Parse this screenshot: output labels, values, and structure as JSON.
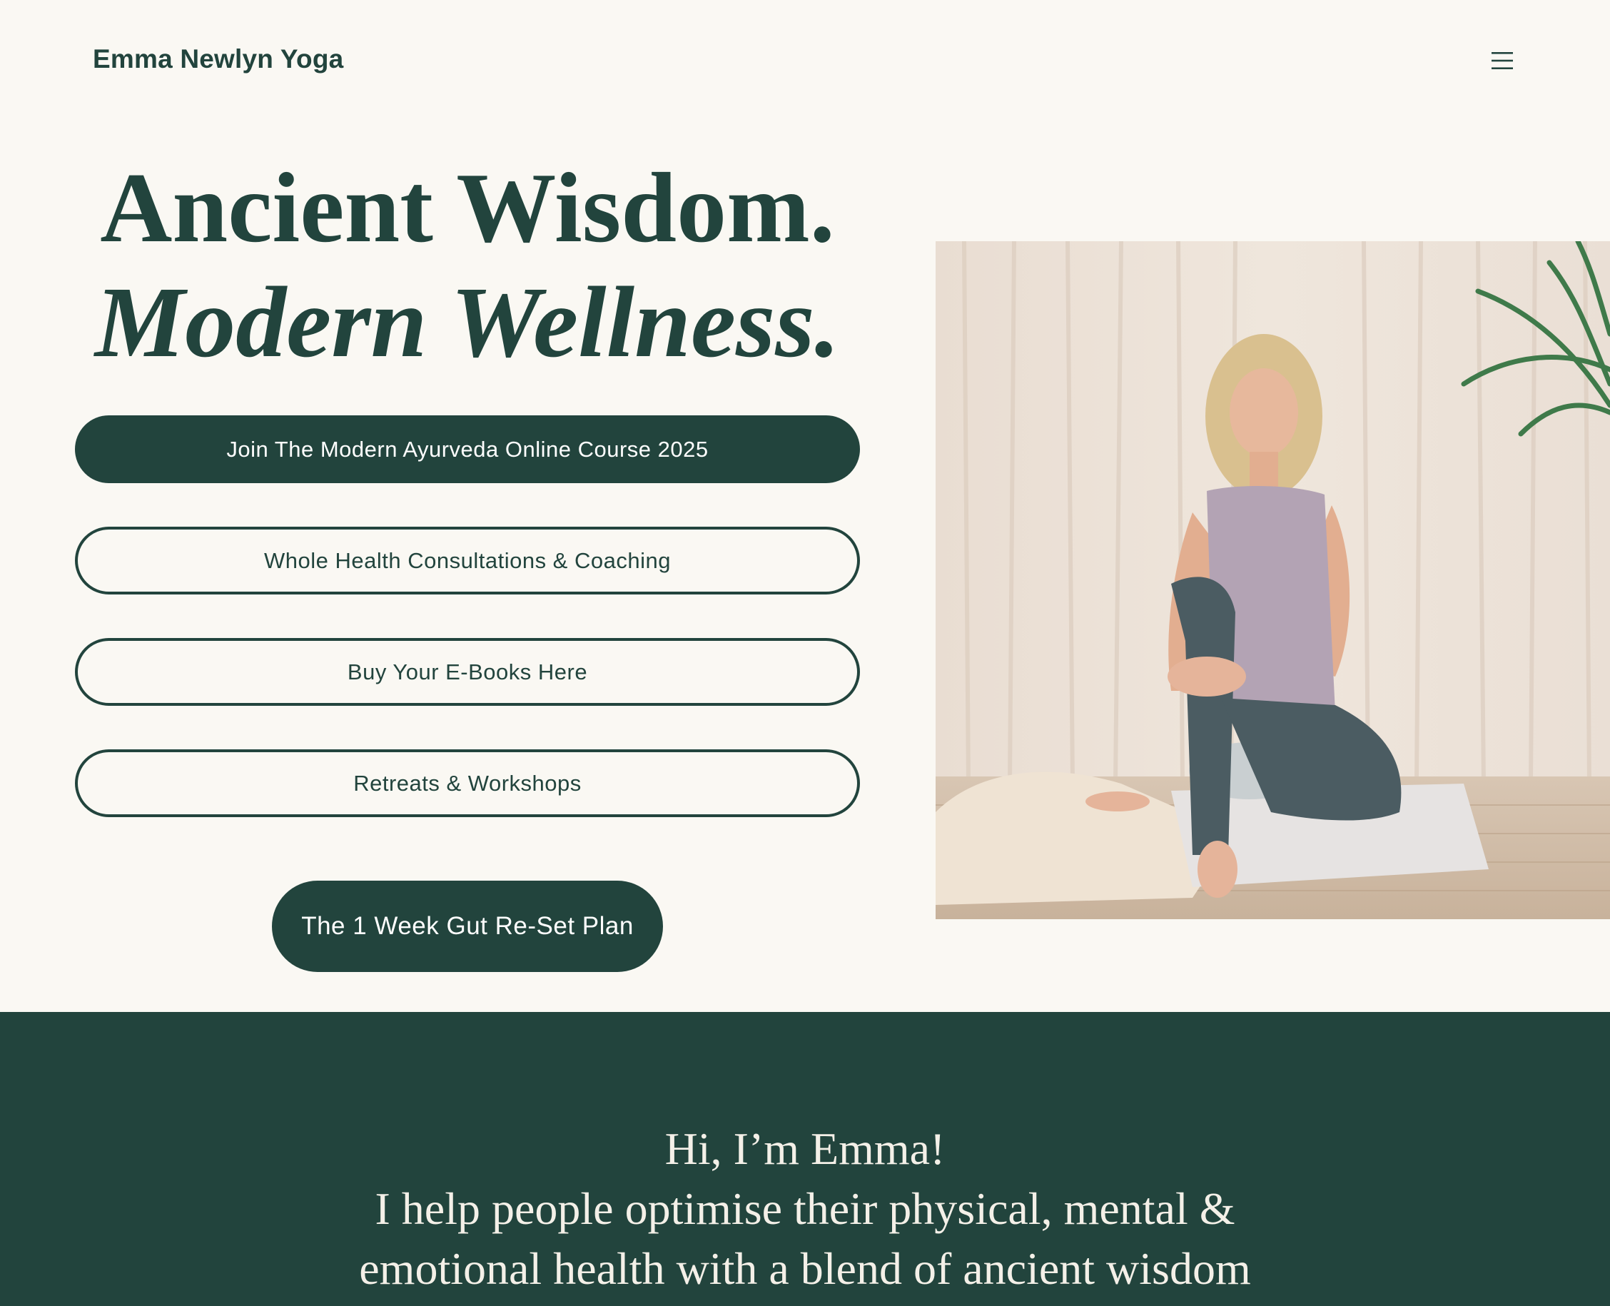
{
  "header": {
    "brand": "Emma Newlyn Yoga",
    "menu_icon": "hamburger-menu-icon"
  },
  "hero": {
    "title_line1": "Ancient Wisdom.",
    "title_line2": "Modern Wellness.",
    "buttons": [
      {
        "label": "Join The Modern Ayurveda Online Course 2025",
        "style": "filled"
      },
      {
        "label": "Whole Health Consultations & Coaching",
        "style": "outline"
      },
      {
        "label": "Buy Your E-Books Here",
        "style": "outline"
      },
      {
        "label": "Retreats & Workshops",
        "style": "outline"
      },
      {
        "label": "The 1 Week Gut Re-Set Plan",
        "style": "filled"
      }
    ],
    "photo": "portrait-photo"
  },
  "intro": {
    "lines": [
      "Hi, I’m Emma!",
      "I help people optimise their physical, mental &",
      "emotional health with a blend of ancient wisdom"
    ]
  },
  "colors": {
    "background": "#faf8f3",
    "primary": "#22443d",
    "on_primary": "#ffffff"
  }
}
